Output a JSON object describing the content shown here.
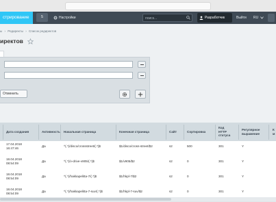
{
  "topbar": {
    "active_tab": "стрирование",
    "notif_count": "5",
    "settings_label": "Настройки",
    "search_placeholder": "поиск...",
    "developer_label": "Разработчик",
    "logout_label": "Выйти",
    "language": "RU"
  },
  "breadcrumbs": [
    "ы",
    "›",
    "Редиректы",
    "›",
    "Список редиректов"
  ],
  "page_title": "иректов",
  "filter": {
    "cancel_label": "Отменить"
  },
  "table": {
    "headers": [
      "Дата создания",
      "Активность",
      "Начальная страница",
      "Конечная страница",
      "Сайт",
      "Сортировка",
      "Код HTTP статуса",
      "Регулярное выражение",
      "К м"
    ],
    "rows": [
      [
        "17.04.2018 16:47:46",
        "Да",
        "^(.*)/disco/crossstreet/(.*)$",
        "$1/disco/cross-street/$2",
        "s2",
        "500",
        "301",
        "Y",
        ""
      ],
      [
        "18.04.2018 08:54:09",
        "Да",
        "^(.*)/v-drive-v905/(.*)$",
        "$1/v905/$2",
        "s2",
        "0",
        "301",
        "Y",
        ""
      ],
      [
        "18.04.2018 08:54:09",
        "Да",
        "^(.*)/hakkapelitta-7/(.*)$",
        "$1/hkpl-7/$2",
        "s2",
        "0",
        "301",
        "Y",
        ""
      ],
      [
        "18.04.2018 08:54:09",
        "Да",
        "^(.*)/hakkapelitta-7-suv/(.*)$",
        "$1/hkpl-7-suv/$2",
        "s2",
        "0",
        "301",
        "Y",
        ""
      ]
    ]
  },
  "colors": {
    "accent": "#2fc6f6",
    "topbar": "#3f4a55",
    "filter_panel": "#d9dfe3",
    "table_header": "#d2dbe0"
  }
}
